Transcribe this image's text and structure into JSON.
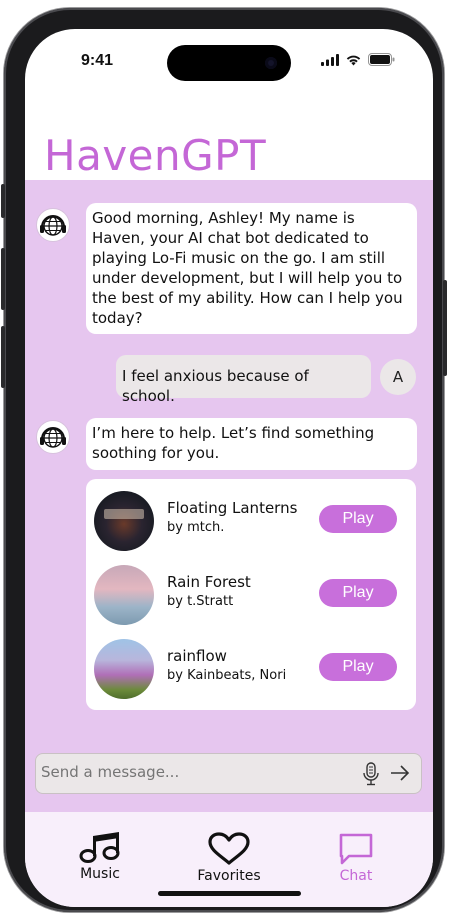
{
  "status_bar": {
    "time": "9:41"
  },
  "app": {
    "title": "HavenGPT",
    "accent_color": "#c467d6",
    "chat_bg": "#e6c6ef"
  },
  "messages": [
    {
      "sender": "bot",
      "avatar_icon": "globe-headphones-icon",
      "text": "Good morning, Ashley! My name is Haven, your AI chat bot dedicated to playing Lo-Fi music on the go. I am still under development, but I will help you to the best of my ability. How can I help you today?"
    },
    {
      "sender": "user",
      "avatar_initial": "A",
      "text": "I feel anxious because of school."
    },
    {
      "sender": "bot",
      "avatar_icon": "globe-headphones-icon",
      "text": "I’m here to help. Let’s find something soothing for you."
    }
  ],
  "songs": [
    {
      "title": "Floating Lanterns",
      "artist": "by mtch.",
      "play_label": "Play"
    },
    {
      "title": "Rain Forest",
      "artist": "by t.Stratt",
      "play_label": "Play"
    },
    {
      "title": "rainflow",
      "artist": "by Kainbeats, Nori",
      "play_label": "Play"
    }
  ],
  "input": {
    "placeholder": "Send a message...",
    "mic_icon": "microphone-icon",
    "send_icon": "arrow-right-icon"
  },
  "nav": [
    {
      "label": "Music",
      "icon": "music-note-icon",
      "active": false
    },
    {
      "label": "Favorites",
      "icon": "heart-icon",
      "active": false
    },
    {
      "label": "Chat",
      "icon": "chat-bubble-icon",
      "active": true,
      "color": "#c467d6"
    }
  ]
}
